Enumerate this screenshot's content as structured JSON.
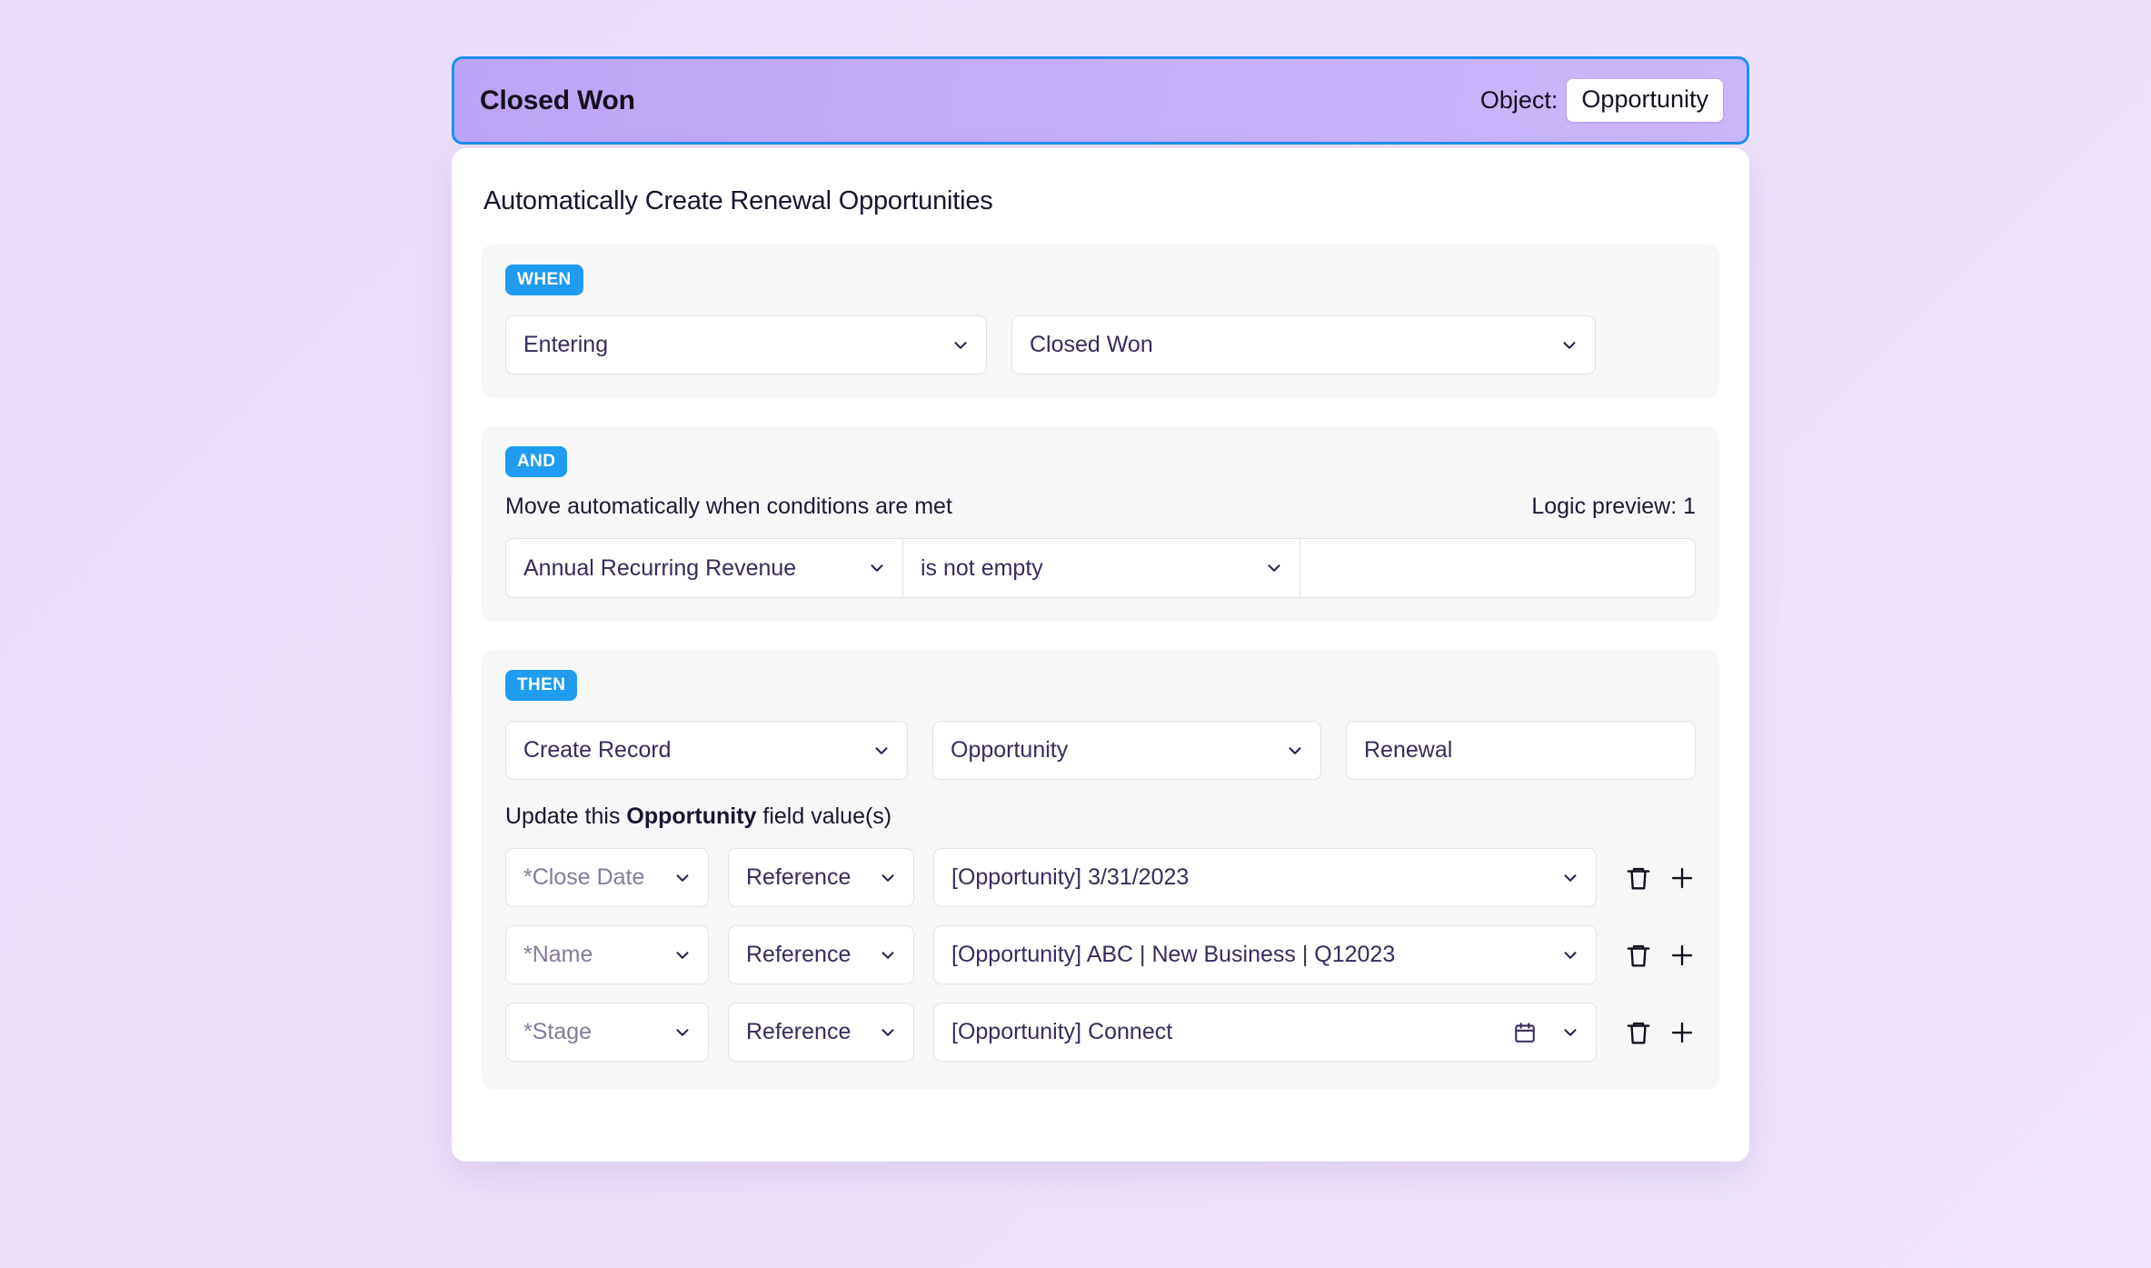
{
  "header": {
    "stage_title": "Closed Won",
    "object_label": "Object:",
    "object_value": "Opportunity"
  },
  "card": {
    "title": "Automatically Create Renewal Opportunities"
  },
  "when_section": {
    "badge": "WHEN",
    "event": "Entering",
    "stage": "Closed Won"
  },
  "and_section": {
    "badge": "AND",
    "description": "Move automatically when conditions are met",
    "logic_preview": "Logic preview: 1",
    "condition": {
      "field": "Annual Recurring Revenue",
      "operator": "is not empty",
      "value": ""
    }
  },
  "then_section": {
    "badge": "THEN",
    "action": "Create Record",
    "record_type": "Opportunity",
    "record_name": "Renewal",
    "update_prefix": "Update this ",
    "update_object": "Opportunity",
    "update_suffix": " field value(s)",
    "mappings": [
      {
        "field": "*Close Date",
        "source": "Reference",
        "value": "[Opportunity] 3/31/2023",
        "has_calendar_icon": false
      },
      {
        "field": "*Name",
        "source": "Reference",
        "value": "[Opportunity] ABC | New Business | Q12023",
        "has_calendar_icon": false
      },
      {
        "field": "*Stage",
        "source": "Reference",
        "value": "[Opportunity] Connect",
        "has_calendar_icon": true
      }
    ]
  },
  "icons": {
    "chevron_down": "chevron-down-icon",
    "calendar": "calendar-icon",
    "delete": "trash-icon",
    "add": "plus-icon"
  },
  "colors": {
    "accent_blue": "#1f9bf0",
    "header_border": "#1f8ef1",
    "header_gradient_start": "#bda4f7",
    "header_gradient_end": "#cbb6fa",
    "page_background": "#ecdff9",
    "text_purple": "#3a2a5e",
    "text_dark": "#1b1430",
    "muted_text": "#857a9c"
  }
}
